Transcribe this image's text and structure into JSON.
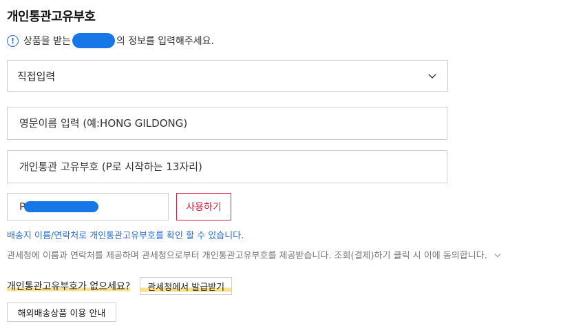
{
  "section": {
    "title": "개인통관고유부호"
  },
  "notice": {
    "icon": "info-icon",
    "icon_glyph": "!",
    "text_before": "상품을 받는",
    "text_after": "의 정보를 입력해주세요."
  },
  "select": {
    "value": "직접입력",
    "icon": "chevron-down-icon"
  },
  "name_field": {
    "placeholder": "영문이름 입력 (예:HONG GILDONG)"
  },
  "code_placeholder_field": {
    "placeholder": "개인통관 고유부호 (P로 시작하는 13자리)"
  },
  "code_field": {
    "value": "P"
  },
  "use_button": {
    "label": "사용하기"
  },
  "help_text": "배송지 이름/연락처로 개인통관고유부호를 확인 할 수 있습니다.",
  "consent": {
    "text": "관세청에 이름과 연락처를 제공하며 관세청으로부터 개인통관고유부호를 제공받습니다. 조회(결제)하기 클릭 시 이에 동의합니다.",
    "icon": "chevron-down-icon"
  },
  "no_code": {
    "question": "개인통관고유부호가 없으세요?",
    "button_label": "관세청에서 발급받기"
  },
  "guide_button": {
    "label": "해외배송상품 이용 안내"
  },
  "colors": {
    "accent_blue": "#2a6fd6",
    "danger_red": "#d81e3c",
    "highlight_yellow": "#fbe28a",
    "border_gray": "#cfcfcf"
  }
}
